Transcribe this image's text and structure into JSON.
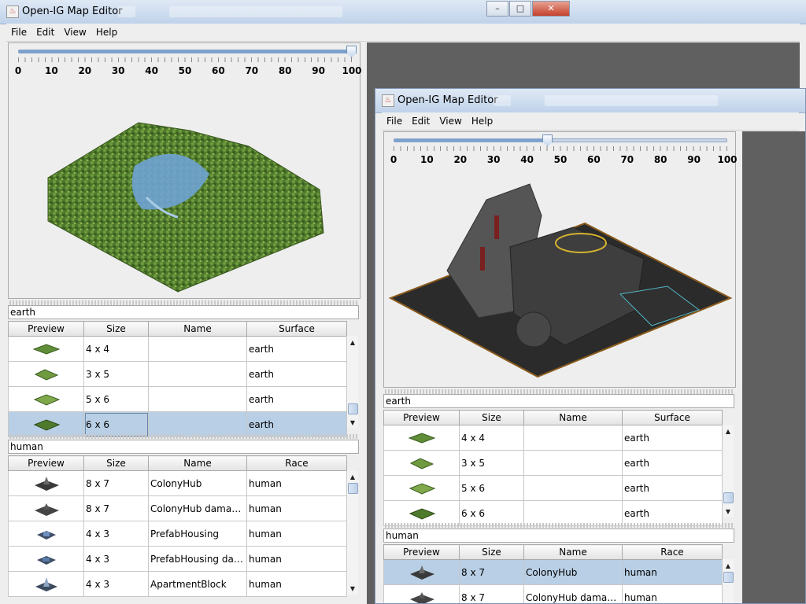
{
  "window1": {
    "title": "Open-IG Map Editor",
    "menu": [
      "File",
      "Edit",
      "View",
      "Help"
    ],
    "slider": {
      "value": 100,
      "ticks": [
        "0",
        "10",
        "20",
        "30",
        "40",
        "50",
        "60",
        "70",
        "80",
        "90",
        "100"
      ]
    },
    "surface_filter": "earth",
    "surface_table": {
      "columns": [
        "Preview",
        "Size",
        "Name",
        "Surface"
      ],
      "rows": [
        {
          "size": "4 x 4",
          "name": "",
          "surface": "earth"
        },
        {
          "size": "3 x 5",
          "name": "",
          "surface": "earth"
        },
        {
          "size": "5 x 6",
          "name": "",
          "surface": "earth"
        },
        {
          "size": "6 x 6",
          "name": "",
          "surface": "earth",
          "selected": true
        }
      ]
    },
    "building_filter": "human",
    "building_table": {
      "columns": [
        "Preview",
        "Size",
        "Name",
        "Race"
      ],
      "rows": [
        {
          "size": "8 x 7",
          "name": "ColonyHub",
          "race": "human"
        },
        {
          "size": "8 x 7",
          "name": "ColonyHub damaged",
          "race": "human"
        },
        {
          "size": "4 x 3",
          "name": "PrefabHousing",
          "race": "human"
        },
        {
          "size": "4 x 3",
          "name": "PrefabHousing dam...",
          "race": "human"
        },
        {
          "size": "4 x 3",
          "name": "ApartmentBlock",
          "race": "human"
        }
      ]
    }
  },
  "window2": {
    "title": "Open-IG Map Editor",
    "menu": [
      "File",
      "Edit",
      "View",
      "Help"
    ],
    "slider": {
      "value": 46,
      "ticks": [
        "0",
        "10",
        "20",
        "30",
        "40",
        "50",
        "60",
        "70",
        "80",
        "90",
        "100"
      ]
    },
    "surface_filter": "earth",
    "surface_table": {
      "columns": [
        "Preview",
        "Size",
        "Name",
        "Surface"
      ],
      "rows": [
        {
          "size": "4 x 4",
          "name": "",
          "surface": "earth"
        },
        {
          "size": "3 x 5",
          "name": "",
          "surface": "earth"
        },
        {
          "size": "5 x 6",
          "name": "",
          "surface": "earth"
        },
        {
          "size": "6 x 6",
          "name": "",
          "surface": "earth"
        }
      ]
    },
    "building_filter": "human",
    "building_table": {
      "columns": [
        "Preview",
        "Size",
        "Name",
        "Race"
      ],
      "rows": [
        {
          "size": "8 x 7",
          "name": "ColonyHub",
          "race": "human",
          "selected": true
        },
        {
          "size": "8 x 7",
          "name": "ColonyHub damaged",
          "race": "human"
        }
      ]
    }
  },
  "colors": {
    "selection": "#b8cfe5",
    "desktop": "#5b5b5b",
    "terrain_green": "#4f7a2e",
    "lake_blue": "#6fa3d3"
  },
  "icons": [
    "app-icon",
    "minimize-icon",
    "maximize-icon",
    "close-icon",
    "scroll-up-icon",
    "scroll-down-icon",
    "terrain-tile-icon",
    "building-tile-icon"
  ]
}
